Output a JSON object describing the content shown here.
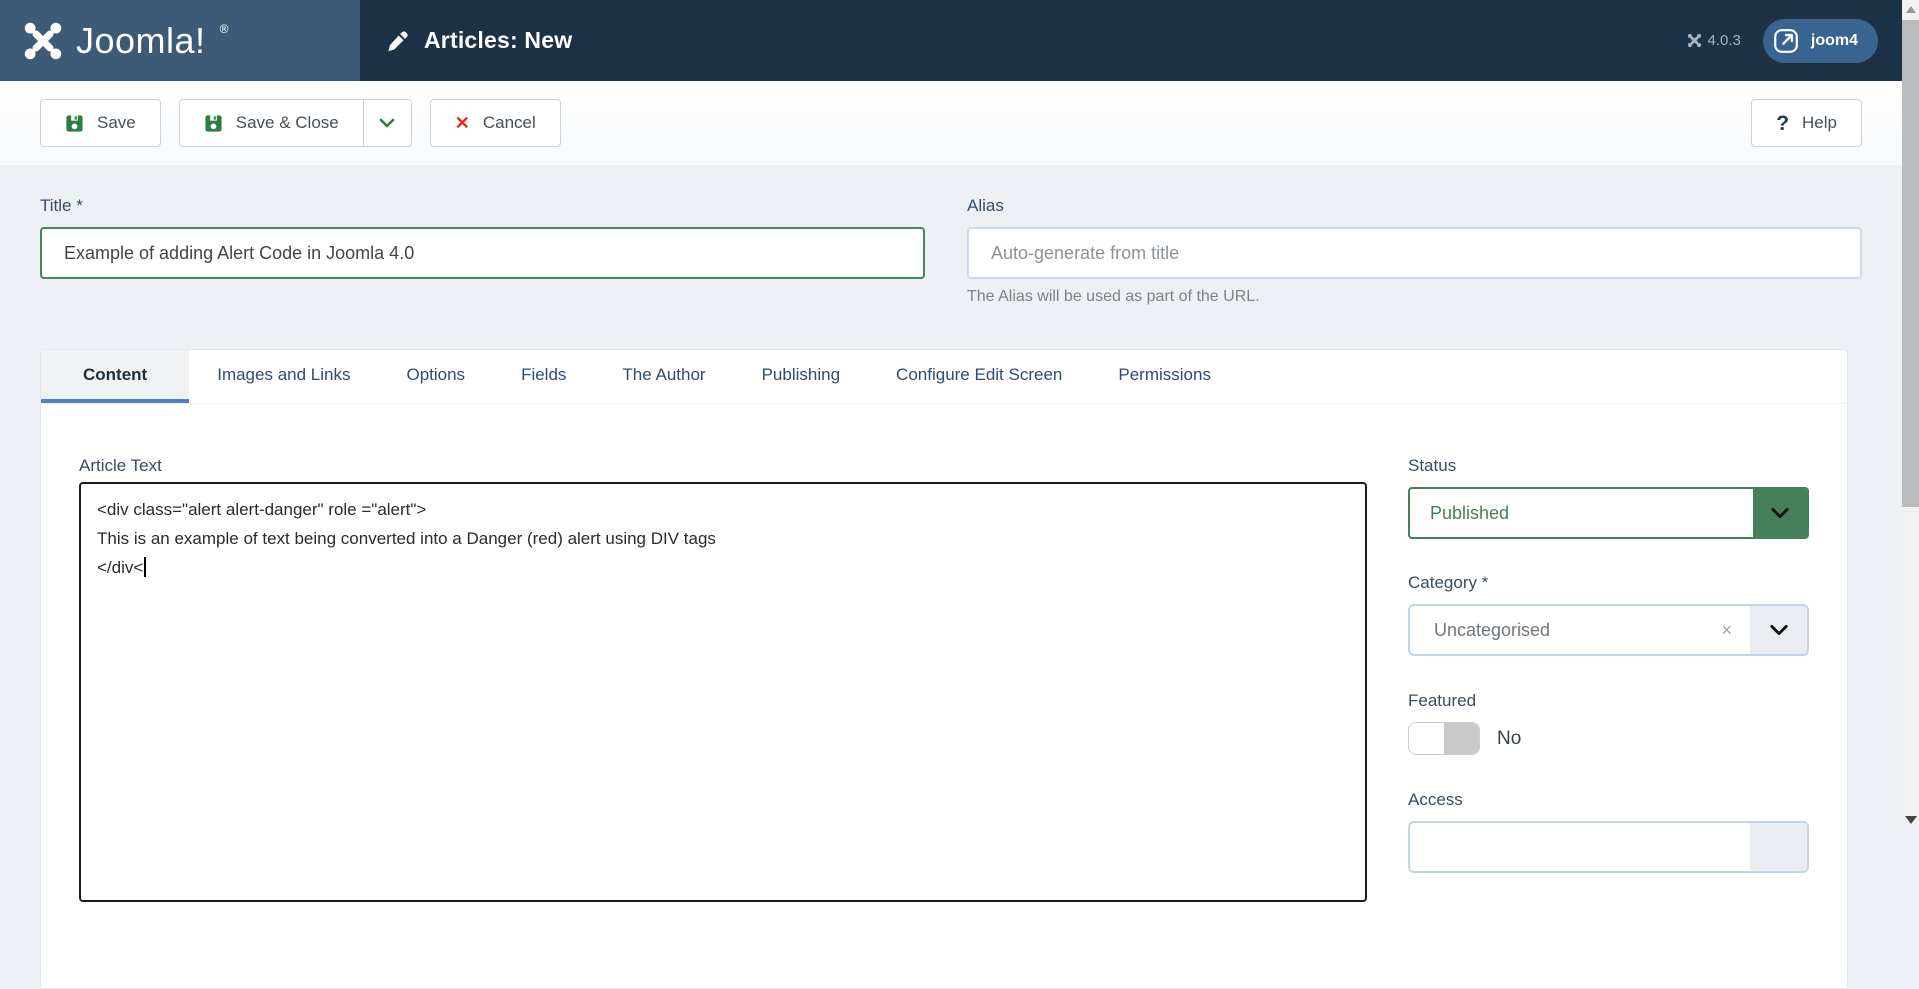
{
  "header": {
    "logo_text": "Joomla!",
    "logo_reg": "®",
    "page_title": "Articles: New",
    "version": "4.0.3",
    "user_button_label": "joom4"
  },
  "toolbar": {
    "save_label": "Save",
    "save_close_label": "Save & Close",
    "cancel_label": "Cancel",
    "help_label": "Help"
  },
  "form": {
    "title_label": "Title *",
    "title_value": "Example of adding Alert Code in Joomla 4.0",
    "alias_label": "Alias",
    "alias_placeholder": "Auto-generate from title",
    "alias_help": "The Alias will be used as part of the URL."
  },
  "tabs": [
    {
      "label": "Content",
      "active": true
    },
    {
      "label": "Images and Links",
      "active": false
    },
    {
      "label": "Options",
      "active": false
    },
    {
      "label": "Fields",
      "active": false
    },
    {
      "label": "The Author",
      "active": false
    },
    {
      "label": "Publishing",
      "active": false
    },
    {
      "label": "Configure Edit Screen",
      "active": false
    },
    {
      "label": "Permissions",
      "active": false
    }
  ],
  "editor": {
    "label": "Article Text",
    "lines": [
      "<div class=\"alert alert-danger\" role =\"alert\">",
      "This is an example of text being converted into a Danger (red) alert using DIV tags",
      "</div<"
    ]
  },
  "sidebar": {
    "status_label": "Status",
    "status_value": "Published",
    "category_label": "Category *",
    "category_value": "Uncategorised",
    "clear_icon": "×",
    "featured_label": "Featured",
    "featured_value": "No",
    "access_label": "Access"
  },
  "icons": {
    "cancel_glyph": "✕",
    "help_glyph": "?"
  },
  "colors": {
    "header_left_bg": "#3d5a76",
    "header_right_bg": "#1e3247",
    "user_pill_bg": "#38648f",
    "status_green": "#45805a",
    "icon_green": "#2e7d42",
    "cancel_red": "#d93025",
    "tab_underline_blue": "#4d82c4",
    "title_border_green": "#44855a",
    "page_bg": "#edf1f6"
  }
}
